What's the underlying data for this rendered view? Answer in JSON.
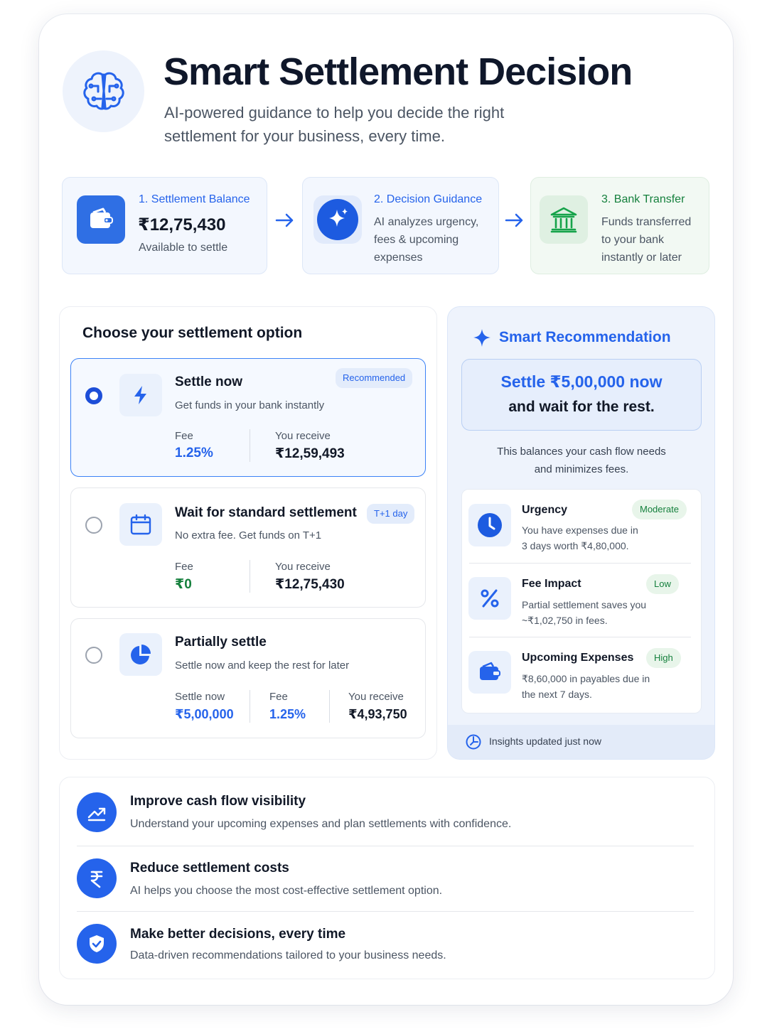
{
  "header": {
    "title": "Smart Settlement Decision",
    "subtitle_line1": "AI-powered guidance to help you decide the right",
    "subtitle_line2": "settlement for your business, every time."
  },
  "steps": [
    {
      "title": "1. Settlement Balance",
      "amount": "₹12,75,430",
      "desc": "Available to settle"
    },
    {
      "title": "2. Decision Guidance",
      "desc_lines": [
        "AI analyzes urgency,",
        "fees & upcoming",
        "expenses"
      ]
    },
    {
      "title": "3. Bank Transfer",
      "desc_lines": [
        "Funds transferred",
        "to your bank",
        "instantly or later"
      ]
    }
  ],
  "options_panel": {
    "title": "Choose your settlement option",
    "options": [
      {
        "title": "Settle now",
        "desc": "Get funds in your bank instantly",
        "badge": "Recommended",
        "selected": true,
        "fee_label": "Fee",
        "fee_value": "1.25%",
        "receive_label": "You receive",
        "receive_value": "₹12,59,493"
      },
      {
        "title": "Wait for standard settlement",
        "desc": "No extra fee. Get funds on T+1",
        "badge": "T+1 day",
        "selected": false,
        "fee_label": "Fee",
        "fee_value": "₹0",
        "receive_label": "You receive",
        "receive_value": "₹12,75,430"
      },
      {
        "title": "Partially settle",
        "desc": "Settle now and keep the rest for later",
        "selected": false,
        "settle_label": "Settle now",
        "settle_value": "₹5,00,000",
        "fee_label": "Fee",
        "fee_value": "1.25%",
        "receive_label": "You receive",
        "receive_value": "₹4,93,750"
      }
    ]
  },
  "recommendation": {
    "title": "Smart Recommendation",
    "headline_line1": "Settle ₹5,00,000 now",
    "headline_line2": "and wait for the rest.",
    "note_line1": "This balances your cash flow needs",
    "note_line2": "and minimizes fees.",
    "insights": [
      {
        "title": "Urgency",
        "pill": "Moderate",
        "desc_line1": "You have expenses due in",
        "desc_line2": "3 days worth ₹4,80,000.",
        "icon": "clock-icon"
      },
      {
        "title": "Fee Impact",
        "pill": "Low",
        "desc_line1": "Partial settlement saves you",
        "desc_line2": "~₹1,02,750 in fees.",
        "icon": "percent-icon"
      },
      {
        "title": "Upcoming Expenses",
        "pill": "High",
        "desc_line1": "₹8,60,000 in payables due in",
        "desc_line2": "the next 7 days.",
        "icon": "wallet-icon"
      }
    ],
    "updated": "Insights updated just now"
  },
  "benefits": [
    {
      "title": "Improve cash flow visibility",
      "desc": "Understand your upcoming expenses and plan settlements with confidence.",
      "icon": "trend-up-icon"
    },
    {
      "title": "Reduce settlement costs",
      "desc": "AI helps you choose the most cost-effective settlement option.",
      "icon": "rupee-icon"
    },
    {
      "title": "Make better decisions, every time",
      "desc": "Data-driven recommendations tailored to your business needs.",
      "icon": "shield-check-icon"
    }
  ],
  "colors": {
    "accent": "#2563eb",
    "success": "#15803d",
    "panel_tint": "#eef3fc"
  }
}
